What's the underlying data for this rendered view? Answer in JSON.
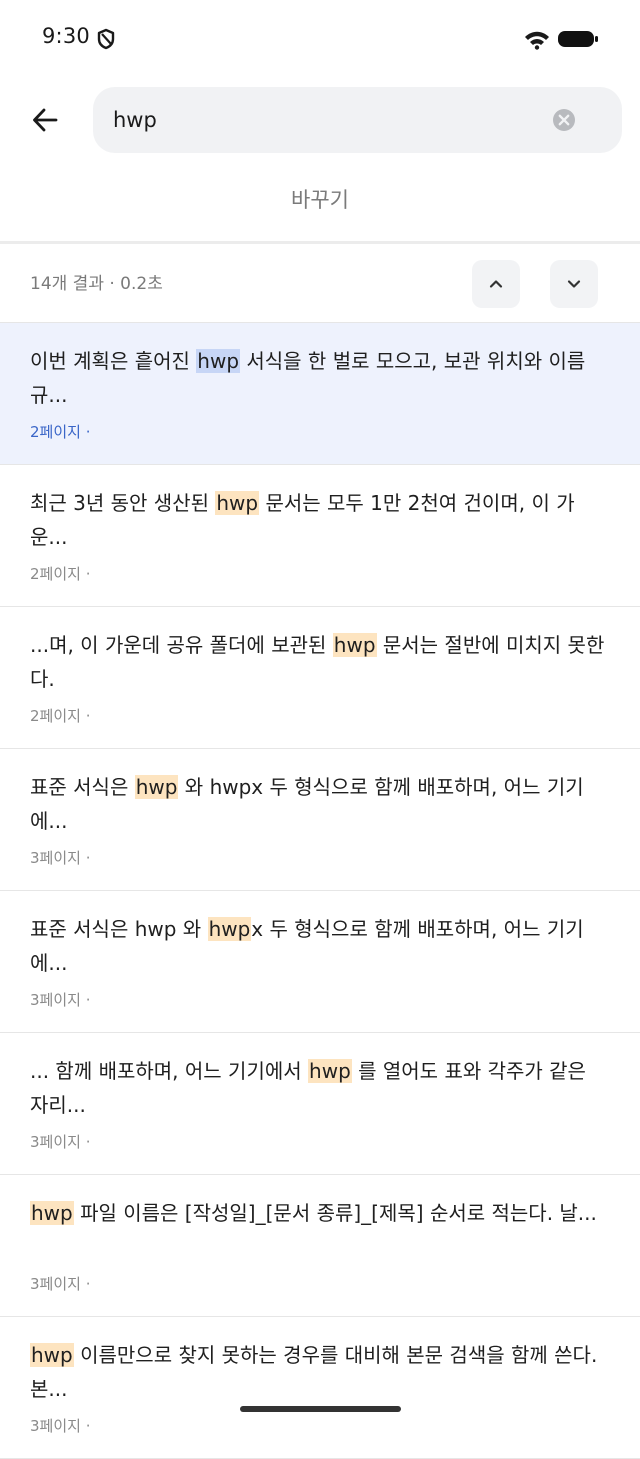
{
  "status_bar": {
    "time": "9:30",
    "icons": [
      "shield-icon",
      "wifi-icon",
      "battery-icon"
    ]
  },
  "search": {
    "query": "hwp",
    "back_icon": "arrow-left-icon",
    "clear_icon": "clear-circle-icon"
  },
  "replace_label": "바꾸기",
  "results_bar": {
    "count_text": "14개 결과 · 0.2초",
    "prev_icon": "chevron-up-icon",
    "next_icon": "chevron-down-icon"
  },
  "colors": {
    "selected_row_bg": "#eef2fd",
    "selected_highlight": "#c7d6f6",
    "match_highlight": "#fde4c0",
    "selected_page_text": "#3a66c8"
  },
  "results": [
    {
      "before": "이번 계획은 흩어진 ",
      "match": "hwp",
      "after": " 서식을 한 벌로 모으고, 보관 위치와 이름 규...",
      "page": "2페이지 ·",
      "selected": true
    },
    {
      "before": "최근 3년 동안 생산된 ",
      "match": "hwp",
      "after": " 문서는 모두 1만 2천여 건이며, 이 가운...",
      "page": "2페이지 ·",
      "selected": false
    },
    {
      "before": "...며, 이 가운데 공유 폴더에 보관된 ",
      "match": "hwp",
      "after": " 문서는 절반에 미치지 못한다.",
      "page": "2페이지 ·",
      "selected": false
    },
    {
      "before": "표준 서식은 ",
      "match": "hwp",
      "after": " 와 hwpx 두 형식으로 함께 배포하며, 어느 기기에...",
      "page": "3페이지 ·",
      "selected": false
    },
    {
      "before": "표준 서식은 hwp 와 ",
      "match": "hwp",
      "after": "x 두 형식으로 함께 배포하며, 어느 기기에...",
      "page": "3페이지 ·",
      "selected": false
    },
    {
      "before": "... 함께 배포하며, 어느 기기에서 ",
      "match": "hwp",
      "after": " 를 열어도 표와 각주가 같은 자리...",
      "page": "3페이지 ·",
      "selected": false
    },
    {
      "before": "",
      "match": "hwp",
      "after": " 파일 이름은 [작성일]_[문서 종류]_[제목] 순서로 적는다. 날...",
      "page": "3페이지 ·",
      "selected": false
    },
    {
      "before": "",
      "match": "hwp",
      "after": " 이름만으로 찾지 못하는 경우를 대비해 본문 검색을 함께 쓴다. 본...",
      "page": "3페이지 ·",
      "selected": false
    }
  ]
}
